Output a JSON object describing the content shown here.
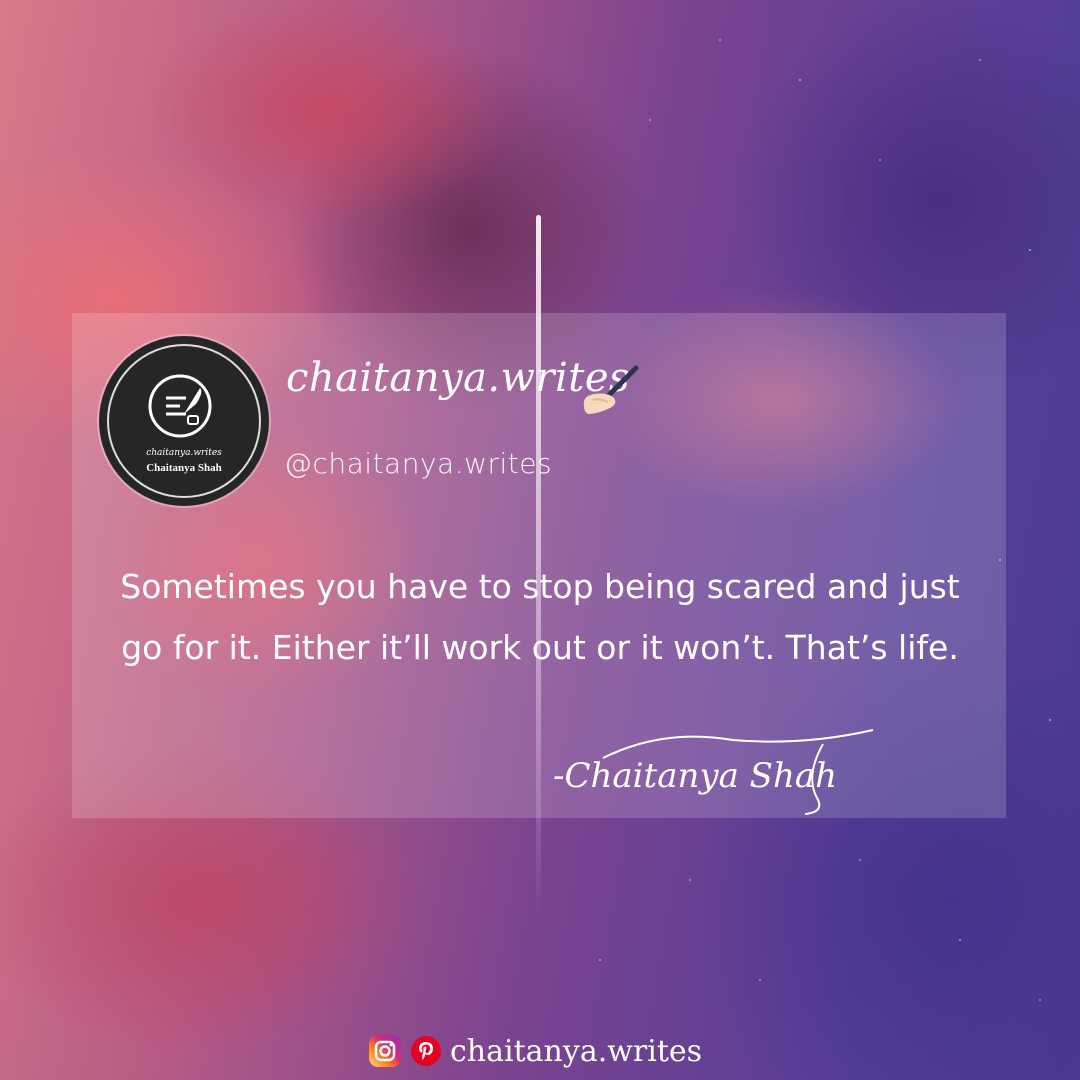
{
  "brand": {
    "title": "chaitanya.writes",
    "handle": "@chaitanya.writes"
  },
  "avatar": {
    "caption": "chaitanya.writes",
    "name": "Chaitanya Shah"
  },
  "quote": {
    "text": "Sometimes you have to stop being scared and just go for it. Either it’ll work out or it won’t. That’s life.",
    "signature": "-Chaitanya Shah"
  },
  "footer": {
    "handle": "chaitanya.writes",
    "icons": [
      "instagram-icon",
      "pinterest-icon"
    ]
  },
  "colors": {
    "pinterest": "#e60023",
    "instagram_start": "#feda75",
    "instagram_end": "#962fbf"
  }
}
